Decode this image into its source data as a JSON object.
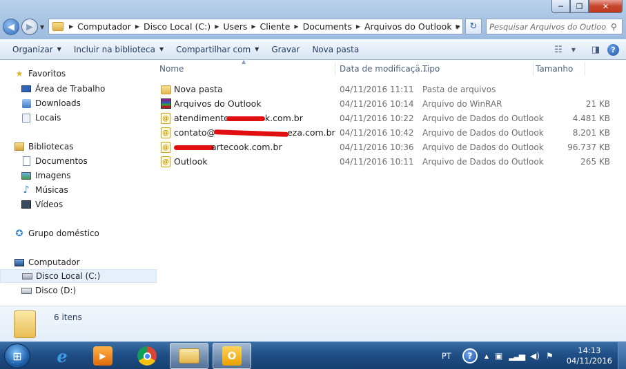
{
  "window": {
    "minimize_glyph": "─",
    "maximize_glyph": "❐",
    "close_glyph": "✕"
  },
  "address": {
    "crumbs": [
      "Computador",
      "Disco Local (C:)",
      "Users",
      "Cliente",
      "Documents",
      "Arquivos do Outlook"
    ],
    "search_placeholder": "Pesquisar Arquivos do Outlook"
  },
  "commands": {
    "organize": "Organizar",
    "include_library": "Incluir na biblioteca",
    "share": "Compartilhar com",
    "burn": "Gravar",
    "new_folder": "Nova pasta"
  },
  "nav": {
    "favorites": "Favoritos",
    "desktop": "Área de Trabalho",
    "downloads": "Downloads",
    "places": "Locais",
    "libraries": "Bibliotecas",
    "documents": "Documentos",
    "images": "Imagens",
    "music": "Músicas",
    "videos": "Vídeos",
    "homegroup": "Grupo doméstico",
    "computer": "Computador",
    "disk_c": "Disco Local (C:)",
    "disk_d": "Disco (D:)"
  },
  "columns": {
    "name": "Nome",
    "date": "Data de modificaçã...",
    "type": "Tipo",
    "size": "Tamanho"
  },
  "files": [
    {
      "name": "Nova pasta",
      "date": "04/11/2016 11:11",
      "type": "Pasta de arquivos",
      "size": "",
      "icon": "folder-icon"
    },
    {
      "name": "Arquivos do Outlook",
      "date": "04/11/2016 10:14",
      "type": "Arquivo do WinRAR",
      "size": "21 KB",
      "icon": "winrar-icon"
    },
    {
      "name_prefix": "atendimento",
      "name_suffix": "k.com.br",
      "date": "04/11/2016 10:22",
      "type": "Arquivo de Dados do Outlook",
      "size": "4.481 KB",
      "icon": "outlook-data-icon"
    },
    {
      "name_prefix": "contato@",
      "name_suffix": "eza.com.br",
      "date": "04/11/2016 10:42",
      "type": "Arquivo de Dados do Outlook",
      "size": "8.201 KB",
      "icon": "outlook-data-icon"
    },
    {
      "name_prefix": "",
      "name_suffix": "artecook.com.br",
      "date": "04/11/2016 10:36",
      "type": "Arquivo de Dados do Outlook",
      "size": "96.737 KB",
      "icon": "outlook-data-icon"
    },
    {
      "name": "Outlook",
      "date": "04/11/2016 10:11",
      "type": "Arquivo de Dados do Outlook",
      "size": "265 KB",
      "icon": "outlook-data-icon"
    }
  ],
  "details": {
    "item_count": "6 itens"
  },
  "taskbar": {
    "language": "PT",
    "time": "14:13",
    "date": "04/11/2016",
    "apps": [
      "internet-explorer-icon",
      "media-player-icon",
      "chrome-icon",
      "windows-explorer-icon",
      "outlook-icon"
    ]
  },
  "colors": {
    "redaction": "#e01010",
    "taskbar": "#1f4f86",
    "selection": "#e5f0fb"
  }
}
